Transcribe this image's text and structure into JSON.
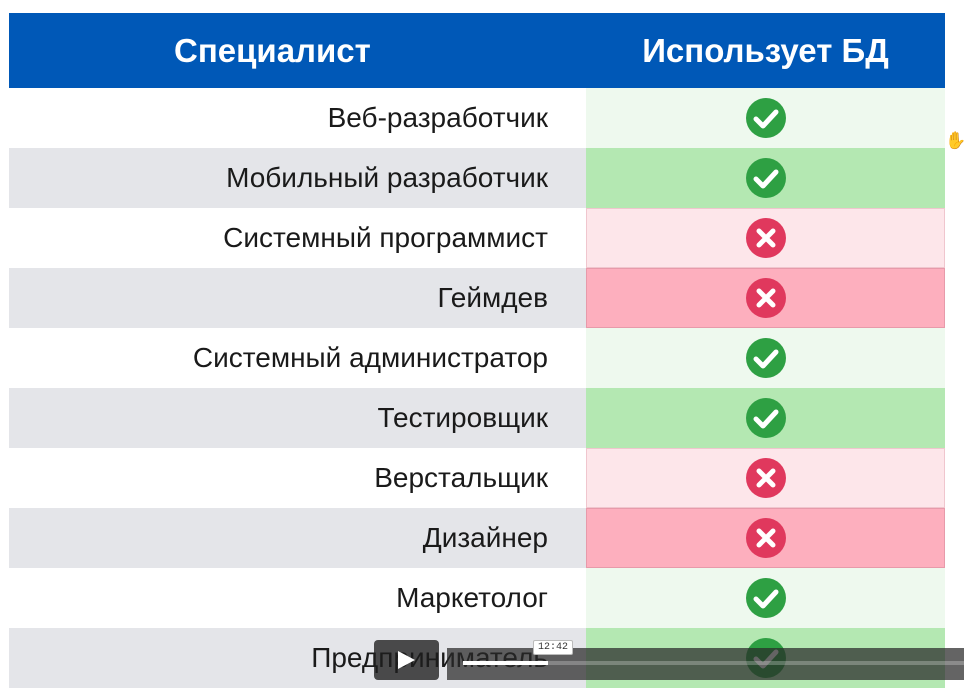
{
  "table": {
    "header": {
      "specialist": "Специалист",
      "uses_db": "Использует БД"
    },
    "rows": [
      {
        "specialist": "Веб-разработчик",
        "uses_db": true
      },
      {
        "specialist": "Мобильный разработчик",
        "uses_db": true
      },
      {
        "specialist": "Системный программист",
        "uses_db": false
      },
      {
        "specialist": "Геймдев",
        "uses_db": false
      },
      {
        "specialist": "Системный администратор",
        "uses_db": true
      },
      {
        "specialist": "Тестировщик",
        "uses_db": true
      },
      {
        "specialist": "Верстальщик",
        "uses_db": false
      },
      {
        "specialist": "Дизайнер",
        "uses_db": false
      },
      {
        "specialist": "Маркетолог",
        "uses_db": true
      },
      {
        "specialist": "Предприниматель",
        "uses_db": true
      }
    ]
  },
  "colors": {
    "header_bg": "#0058b7",
    "check": "#2ea043",
    "cross": "#e0385d"
  },
  "icons": {
    "yes": "check-circle-icon",
    "no": "x-circle-icon"
  },
  "video": {
    "hover_time": "12:42",
    "play_icon": "play-icon",
    "cursor_icon": "hand-cursor-icon"
  }
}
